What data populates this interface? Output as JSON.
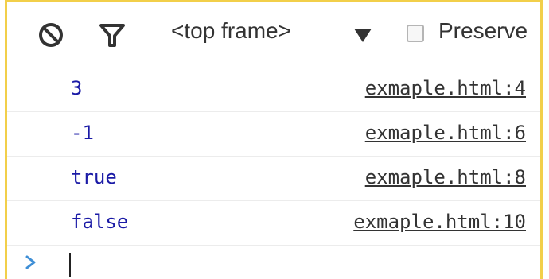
{
  "toolbar": {
    "icons": [
      "clear-console-icon",
      "filter-icon"
    ],
    "context_selector": "<top frame>",
    "preserve_label": "Preserve",
    "preserve_checked": false
  },
  "console": {
    "messages": [
      {
        "value": "3",
        "source": "exmaple.html:4"
      },
      {
        "value": "-1",
        "source": "exmaple.html:6"
      },
      {
        "value": "true",
        "source": "exmaple.html:8"
      },
      {
        "value": "false",
        "source": "exmaple.html:10"
      }
    ],
    "prompt_value": ""
  },
  "colors": {
    "frame_border": "#f2cf4a",
    "value_text": "#1a1aa6",
    "prompt_chevron": "#3f8fd6",
    "icon": "#333333"
  }
}
